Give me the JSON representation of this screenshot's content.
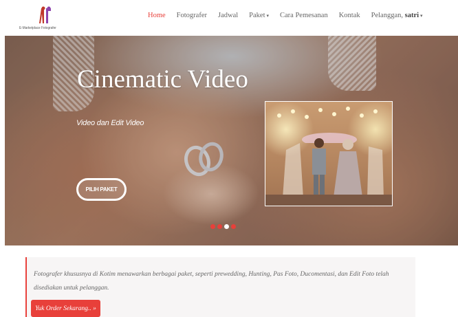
{
  "brand": {
    "name": "E-Marketplace Fotografer",
    "logo_color": "#c0392b"
  },
  "nav": {
    "items": [
      {
        "label": "Home",
        "active": true
      },
      {
        "label": "Fotografer",
        "active": false
      },
      {
        "label": "Jadwal",
        "active": false
      },
      {
        "label": "Paket",
        "active": false,
        "dropdown": true
      },
      {
        "label": "Cara Pemesanan",
        "active": false
      },
      {
        "label": "Kontak",
        "active": false
      }
    ],
    "user_prefix": "Pelanggan,",
    "user_name": "satri"
  },
  "hero": {
    "title": "Cinematic Video",
    "subtitle": "Video dan Edit Video",
    "button_label": "PILIH PAKET",
    "slides": 4,
    "active_slide": 3
  },
  "info": {
    "text": "Fotografer khususnya di Kotim menawarkan berbagai paket, seperti prewedding, Hunting, Pas Foto, Ducomentasi, dan Edit Foto telah disediakan untuk pelanggan.",
    "order_button": "Yuk Order Sekarang.. »"
  },
  "colors": {
    "accent": "#e8403a",
    "nav_text": "#666666",
    "info_bg": "#f7f5f5"
  },
  "icons": {
    "dropdown": "caret-down-icon"
  }
}
